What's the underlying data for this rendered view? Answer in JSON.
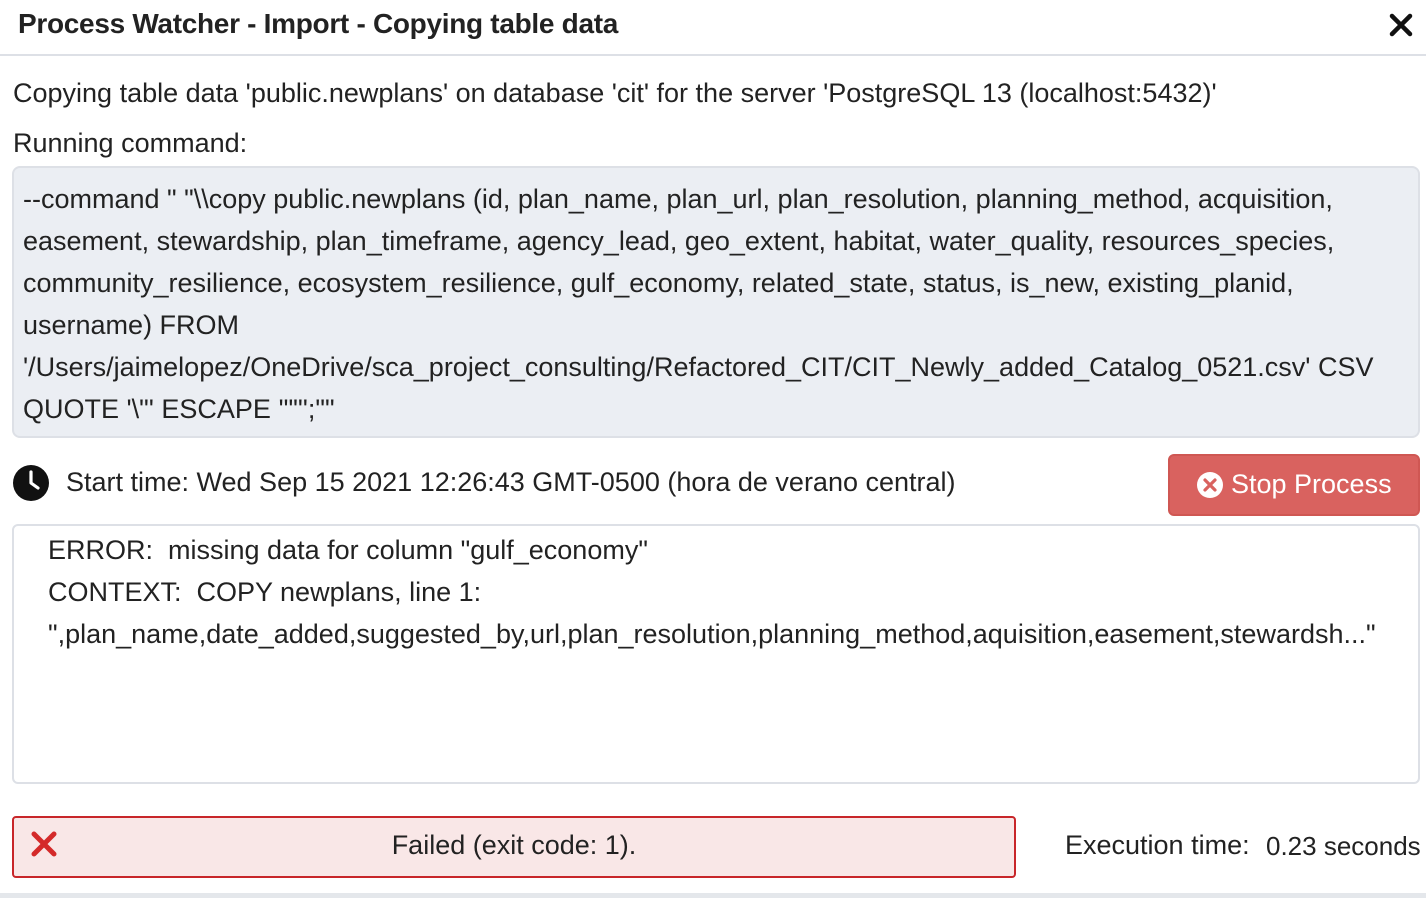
{
  "dialog": {
    "title": "Process Watcher - Import - Copying table data",
    "close_icon": "close-icon"
  },
  "description": "Copying table data 'public.newplans' on database 'cit' for the server 'PostgreSQL 13 (localhost:5432)'",
  "command": {
    "label": "Running command:",
    "text": "--command \" \"\\\\copy public.newplans (id, plan_name, plan_url, plan_resolution, planning_method, acquisition, easement, stewardship, plan_timeframe, agency_lead, geo_extent, habitat, water_quality, resources_species, community_resilience, ecosystem_resilience, gulf_economy, related_state, status, is_new, existing_planid, username) FROM '/Users/jaimelopez/OneDrive/sca_project_consulting/Refactored_CIT/CIT_Newly_added_Catalog_0521.csv' CSV QUOTE '\\\"' ESCAPE '\"\"';\"\""
  },
  "start": {
    "icon": "clock-icon",
    "text": "Start time: Wed Sep 15 2021 12:26:43 GMT-0500 (hora de verano central)"
  },
  "stop_button": {
    "icon": "times-circle-icon",
    "label": "Stop Process",
    "color": "#d9625f"
  },
  "log": {
    "lines": [
      "ERROR:  missing data for column \"gulf_economy\"",
      "CONTEXT:  COPY newplans, line 1:",
      "\",plan_name,date_added,suggested_by,url,plan_resolution,planning_method,aquisition,easement,stewardsh...\""
    ]
  },
  "status": {
    "icon": "error-x-icon",
    "text": "Failed (exit code: 1).",
    "border_color": "#c8262a",
    "background_color": "#f9e7e7"
  },
  "execution": {
    "label": "Execution time:",
    "value": "0.23 seconds"
  }
}
